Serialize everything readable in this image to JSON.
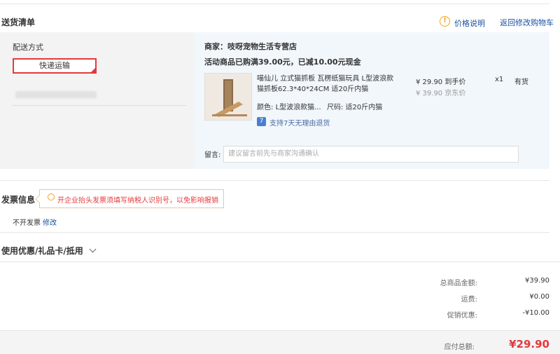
{
  "header": {
    "title": "送货清单",
    "price_info_label": "价格说明",
    "back_to_cart_label": "返回修改购物车"
  },
  "delivery": {
    "method_label": "配送方式",
    "method_value": "快递运输"
  },
  "shop": {
    "shop_line": "商家：吱呀宠物生活专营店",
    "promo_line": "活动商品已购满39.00元，已减10.00元现金",
    "product": {
      "title": "喵仙儿 立式猫抓板 瓦楞纸猫玩具 L型波浪款猫抓板62.3*40*24CM 适20斤内猫",
      "color_label": "颜色:",
      "color_value": "L型波浪款猫...",
      "size_label": "尺码:",
      "size_value": "适20斤内猫",
      "return_badge": "7",
      "return_text": "支持7天无理由退货",
      "price_now": "¥ 29.90 到手价",
      "price_orig": "¥ 39.90 京东价",
      "quantity": "x1",
      "stock": "有货"
    },
    "message_label": "留言:",
    "message_placeholder": "建议留言前先与商家沟通确认"
  },
  "invoice": {
    "title": "发票信息",
    "tip": "开企业抬头发票须填写纳税人识别号，以免影响报销",
    "status": "不开发票",
    "modify_label": "修改"
  },
  "coupon": {
    "title": "使用优惠/礼品卡/抵用"
  },
  "summary": {
    "total_goods_label": "总商品金额:",
    "total_goods_value": "¥39.90",
    "shipping_label": "运费:",
    "shipping_value": "¥0.00",
    "discount_label": "促销优惠:",
    "discount_value": "-¥10.00",
    "payable_label": "应付总额:",
    "payable_value": "¥29.90"
  },
  "colors": {
    "accent_red": "#e4393c",
    "link_blue": "#1a4fa0",
    "shop_bg": "#f2f7fc",
    "warning_orange": "#f0a020"
  }
}
